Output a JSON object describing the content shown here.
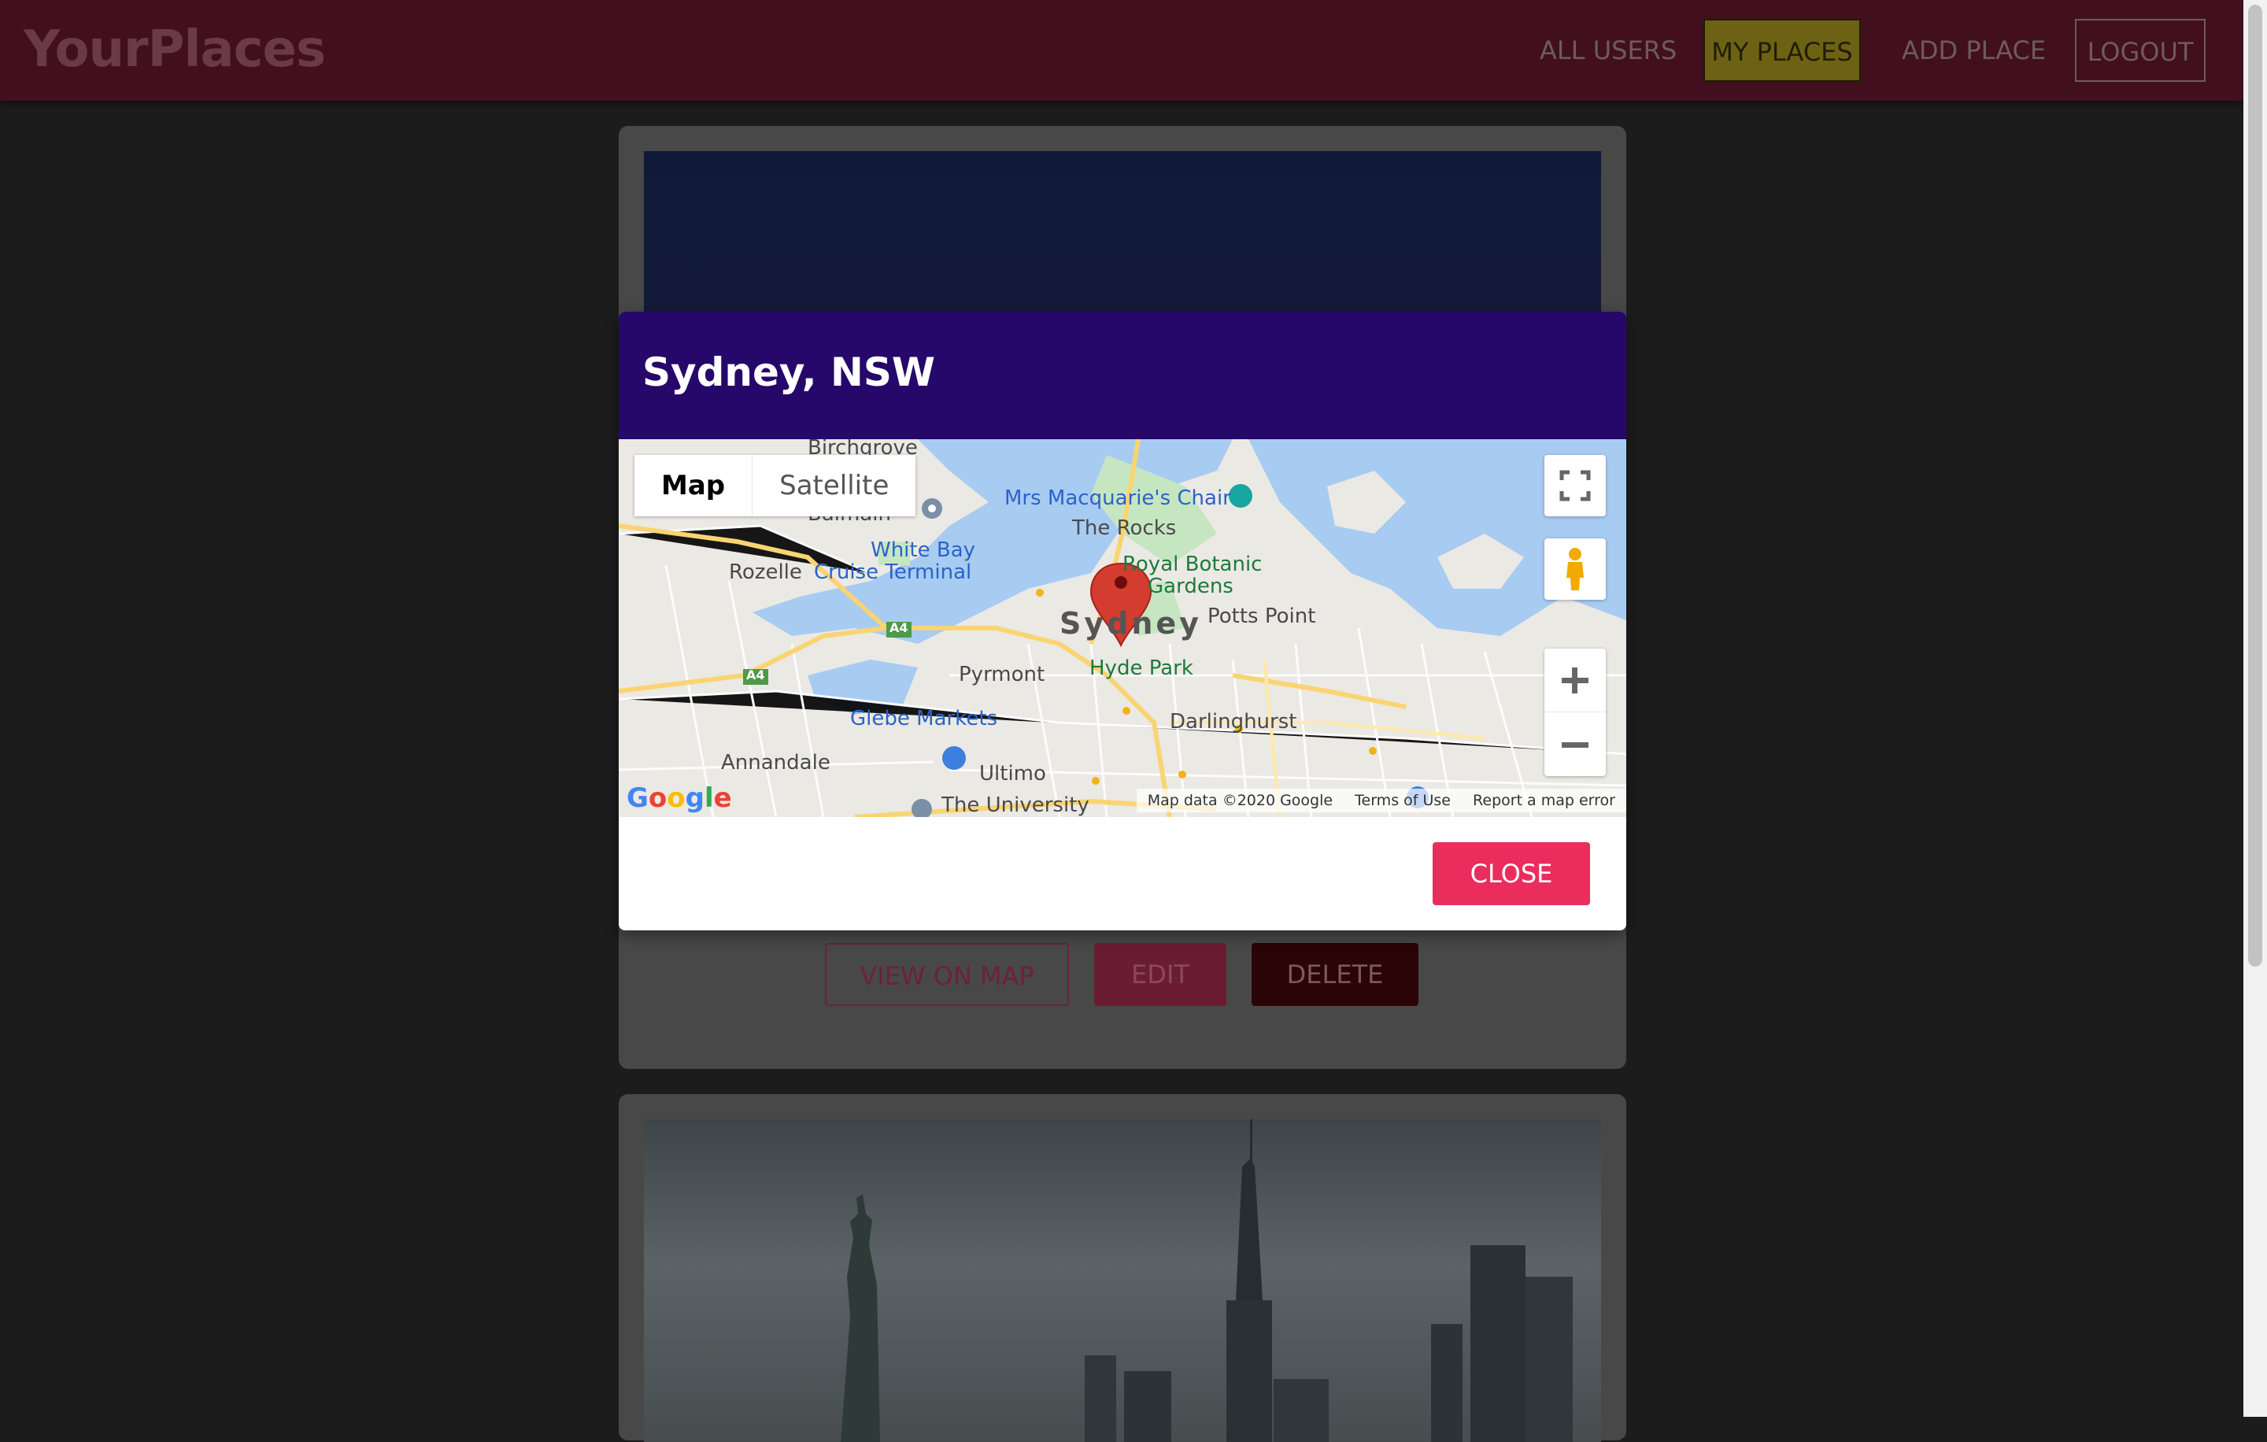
{
  "header": {
    "logo": "YourPlaces",
    "nav": [
      "ALL USERS",
      "MY PLACES",
      "ADD PLACE",
      "LOGOUT"
    ]
  },
  "card": {
    "buttons": {
      "view": "VIEW ON MAP",
      "edit": "EDIT",
      "delete": "DELETE"
    }
  },
  "modal": {
    "title": "Sydney, NSW",
    "close_label": "CLOSE",
    "map": {
      "type_buttons": [
        "Map",
        "Satellite"
      ],
      "labels": {
        "birchgrove": "Birchgrove",
        "balmain": "Balmain",
        "mrs_macquarie": "Mrs Macquarie's Chair",
        "the_rocks": "The Rocks",
        "white_bay": "White Bay",
        "cruise_terminal": "Cruise Terminal",
        "rozelle": "Rozelle",
        "royal_botanic": "Royal Botanic",
        "gardens": "Gardens",
        "sydney": "Sydney",
        "potts_point": "Potts Point",
        "pyrmont": "Pyrmont",
        "hyde_park": "Hyde Park",
        "glebe_markets": "Glebe Markets",
        "darlinghurst": "Darlinghurst",
        "annandale": "Annandale",
        "ultimo": "Ultimo",
        "the_university": "The University",
        "a4_1": "A4",
        "a4_2": "A4"
      },
      "google": "Google",
      "attribution": {
        "data": "Map data ©2020 Google",
        "terms": "Terms of Use",
        "report": "Report a map error"
      }
    }
  },
  "colors": {
    "header_bg": "#420f1e",
    "modal_header_bg": "#26086b",
    "close_button": "#ea2d5d",
    "marker": "#d33c2e",
    "water": "#a8cbf2"
  }
}
